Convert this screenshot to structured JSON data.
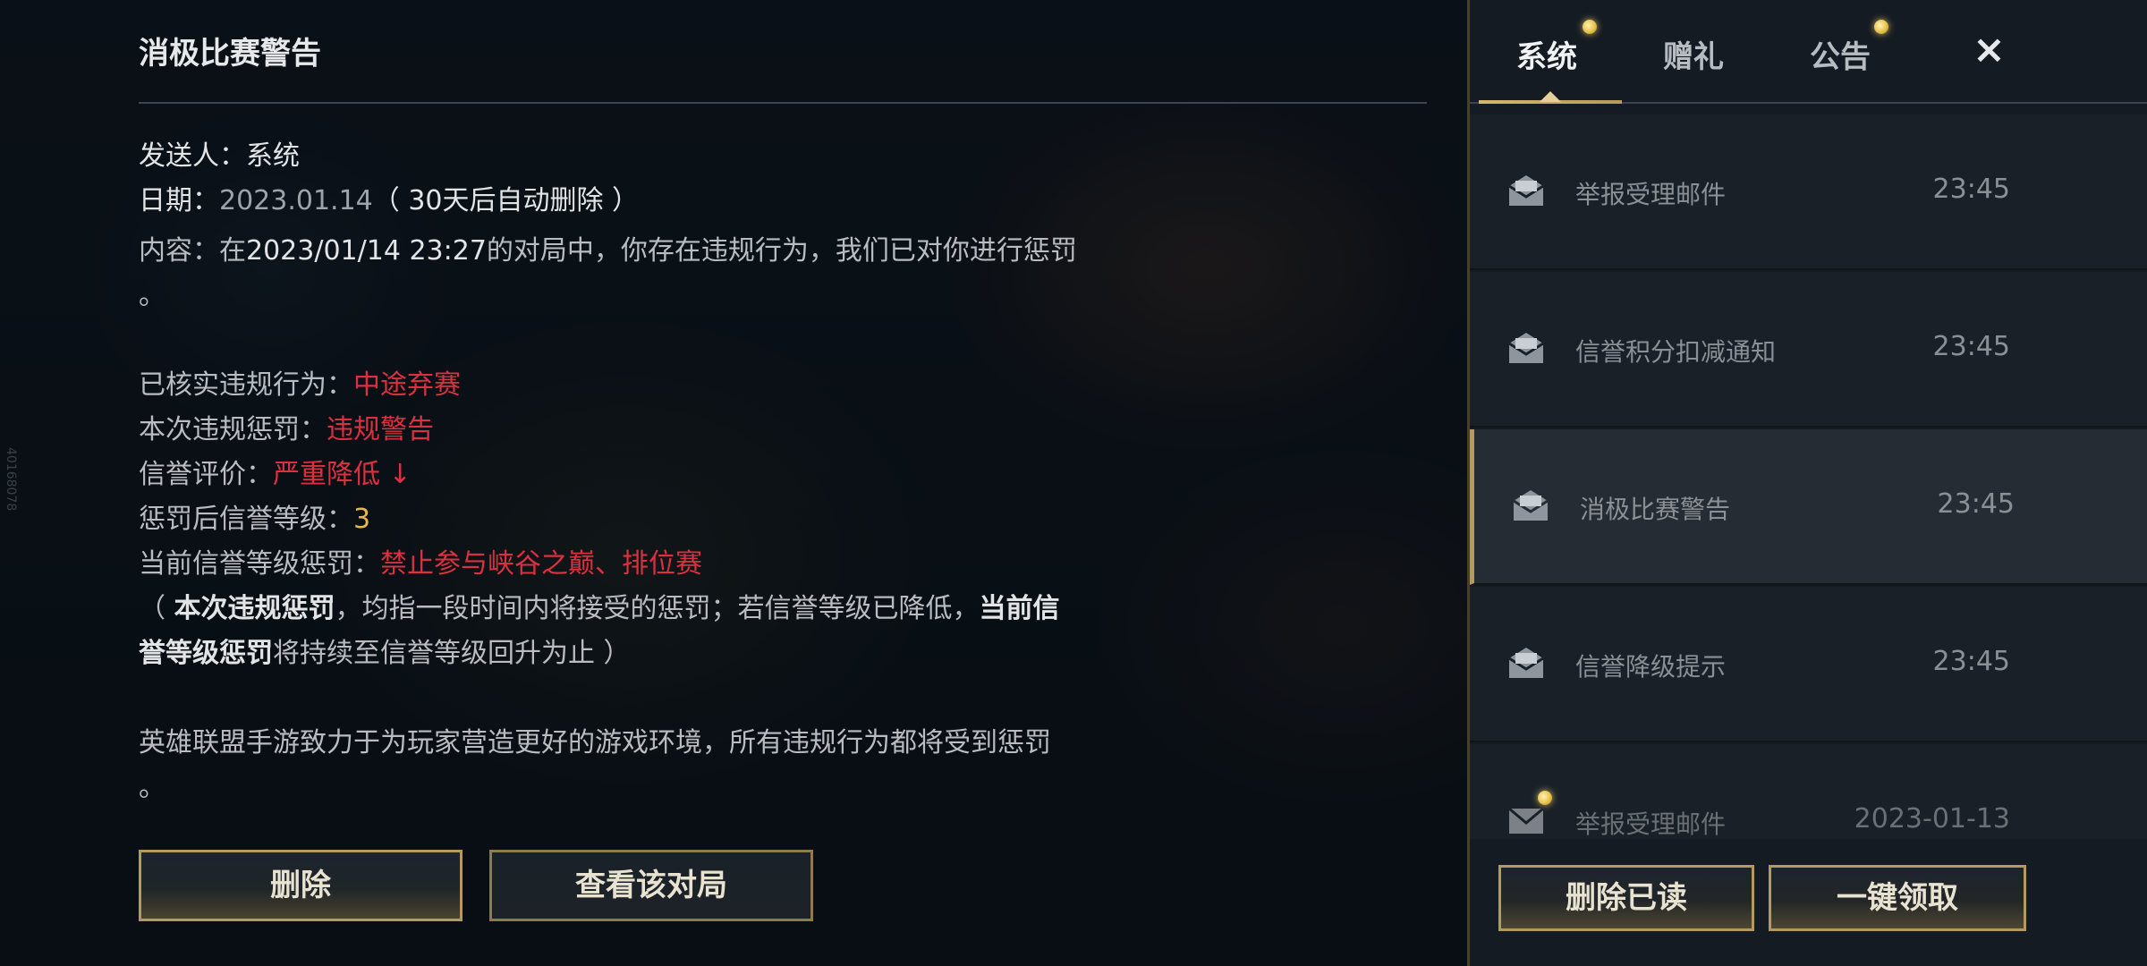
{
  "detail": {
    "title": "消极比赛警告",
    "sender_label": "发送人：",
    "sender_value": "系统",
    "date_label": "日期：",
    "date_value": "2023.01.14",
    "date_note": "（ 30天后自动删除 ）",
    "content_label": "内容：",
    "content_pre": "在",
    "content_time": "2023/01/14 23:27",
    "content_post": "的对局中，你存在违规行为，我们已对你进行惩罚",
    "content_end": "。",
    "violation_label": "已核实违规行为：",
    "violation_value": "中途弃赛",
    "penalty_label": "本次违规惩罚：",
    "penalty_value": "违规警告",
    "credit_label": "信誉评价：",
    "credit_value": "严重降低 ↓",
    "level_label": "惩罚后信誉等级：",
    "level_value": "3",
    "current_label": "当前信誉等级惩罚：",
    "current_value": "禁止参与峡谷之巅、排位赛",
    "note_open": "（ ",
    "note_bold1": "本次违规惩罚",
    "note_mid": "，均指一段时间内将接受的惩罚；若信誉等级已降低，",
    "note_bold2a": "当前信",
    "note_bold2b": "誉等级惩罚",
    "note_end": "将持续至信誉等级回升为止 ）",
    "closing": "英雄联盟手游致力于为玩家营造更好的游戏环境，所有违规行为都将受到惩罚",
    "closing_end": "。",
    "delete_button": "删除",
    "view_match_button": "查看该对局",
    "side_id": "40168078"
  },
  "tabs": [
    {
      "label": "系统",
      "active": true,
      "has_dot": true
    },
    {
      "label": "赠礼",
      "active": false,
      "has_dot": false
    },
    {
      "label": "公告",
      "active": false,
      "has_dot": true
    }
  ],
  "close_icon": "×",
  "mails": [
    {
      "title": "举报受理邮件",
      "time": "23:45",
      "icon": "opened-mail-icon",
      "selected": false
    },
    {
      "title": "信誉积分扣减通知",
      "time": "23:45",
      "icon": "opened-mail-icon",
      "selected": false
    },
    {
      "title": "消极比赛警告",
      "time": "23:45",
      "icon": "opened-mail-icon",
      "selected": true
    },
    {
      "title": "信誉降级提示",
      "time": "23:45",
      "icon": "opened-mail-icon",
      "selected": false
    },
    {
      "title": "举报受理邮件",
      "time": "2023-01-13",
      "icon": "unread-mail-icon",
      "selected": false,
      "unread": true
    }
  ],
  "actions": {
    "delete_read": "删除已读",
    "claim_all": "一键领取"
  },
  "colors": {
    "gold_border": "#b69a5d",
    "red_text": "#d9313f",
    "gold_text": "#e6b84a"
  }
}
